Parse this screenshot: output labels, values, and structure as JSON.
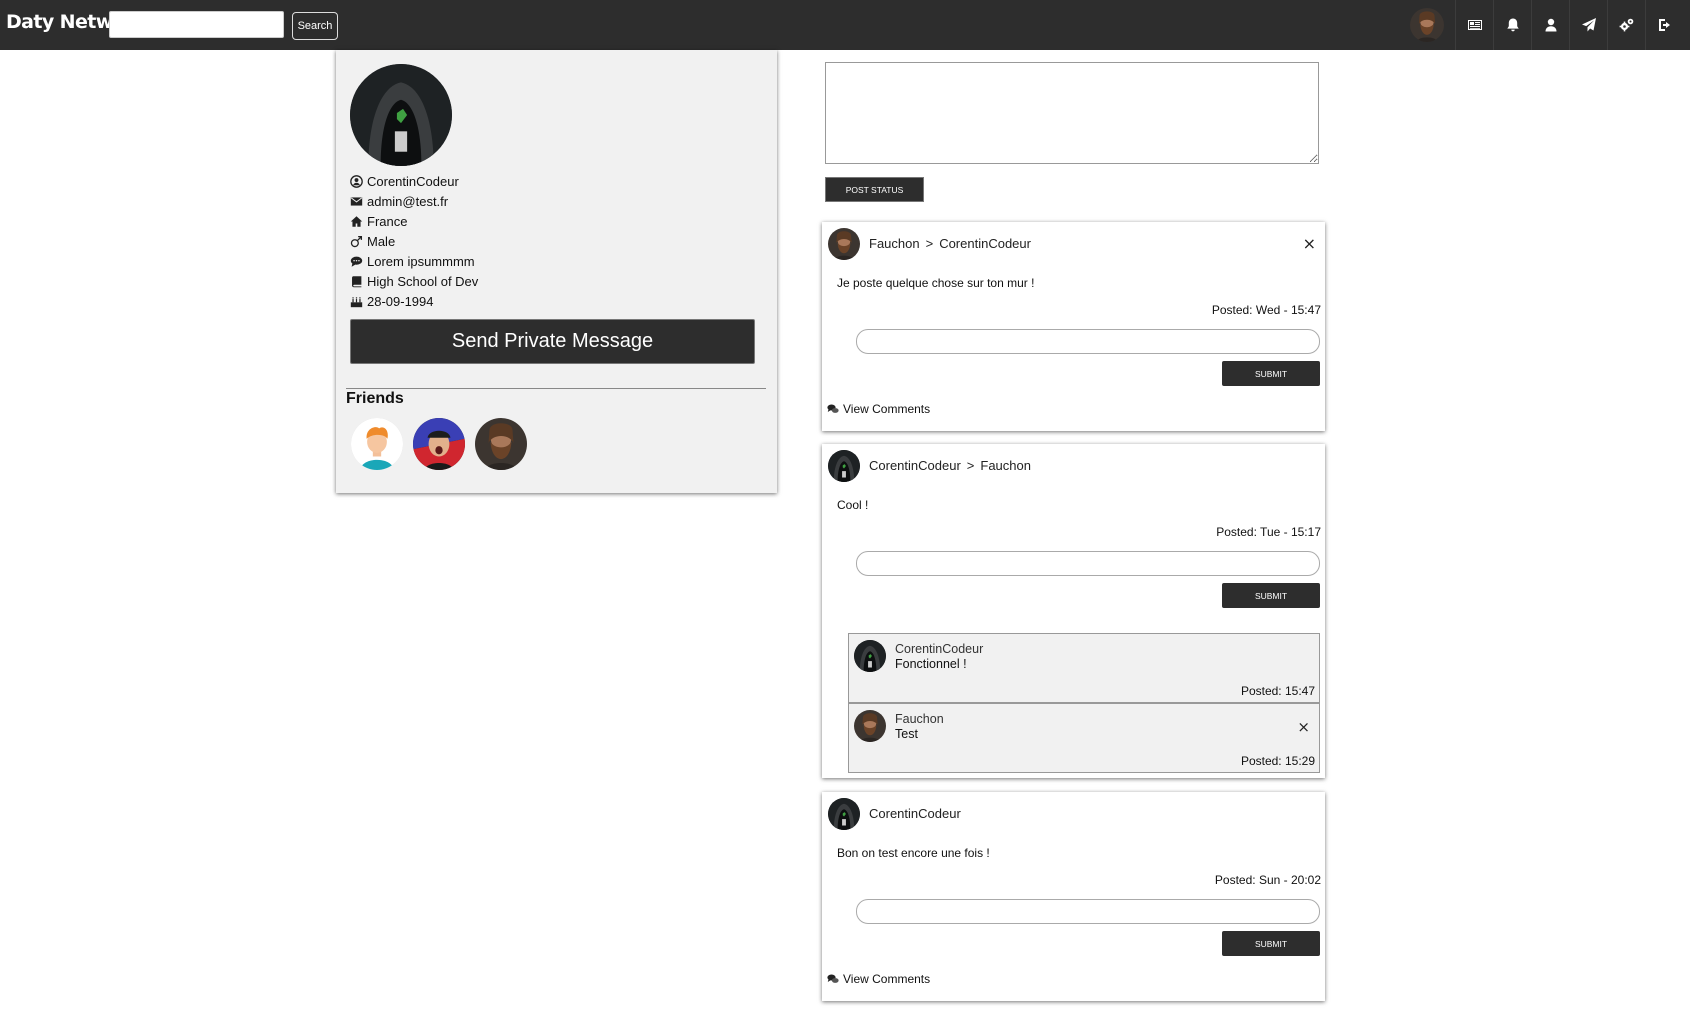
{
  "app": {
    "brand": "Daty Network"
  },
  "search": {
    "placeholder": "",
    "button_label": "Search"
  },
  "nav": {
    "icons": [
      "news-icon",
      "bell-icon",
      "user-icon",
      "paper-plane-icon",
      "cogs-icon",
      "sign-out-icon"
    ]
  },
  "profile": {
    "username": "CorentinCodeur",
    "email": "admin@test.fr",
    "country": "France",
    "gender": "Male",
    "bio": "Lorem ipsummmm",
    "school": "High School of Dev",
    "birthday": "28-09-1994",
    "pm_button": "Send Private Message",
    "friends_title": "Friends"
  },
  "composer": {
    "post_button": "POST STATUS"
  },
  "posts": [
    {
      "author": "Fauchon",
      "separator": ">",
      "target": "CorentinCodeur",
      "text": "Je poste quelque chose sur ton mur !",
      "date": "Posted: Wed - 15:47",
      "submit": "SUBMIT",
      "view_comments": "View Comments",
      "close": "×"
    },
    {
      "author": "CorentinCodeur",
      "separator": ">",
      "target": "Fauchon",
      "text": "Cool !",
      "date": "Posted: Tue - 15:17",
      "submit": "SUBMIT",
      "comments": [
        {
          "author": "CorentinCodeur",
          "text": "Fonctionnel !",
          "date": "Posted: 15:47"
        },
        {
          "author": "Fauchon",
          "text": "Test",
          "date": "Posted: 15:29",
          "close": "×"
        }
      ]
    },
    {
      "author": "CorentinCodeur",
      "text": "Bon on test encore une fois !",
      "date": "Posted: Sun - 20:02",
      "submit": "SUBMIT",
      "view_comments": "View Comments"
    }
  ]
}
